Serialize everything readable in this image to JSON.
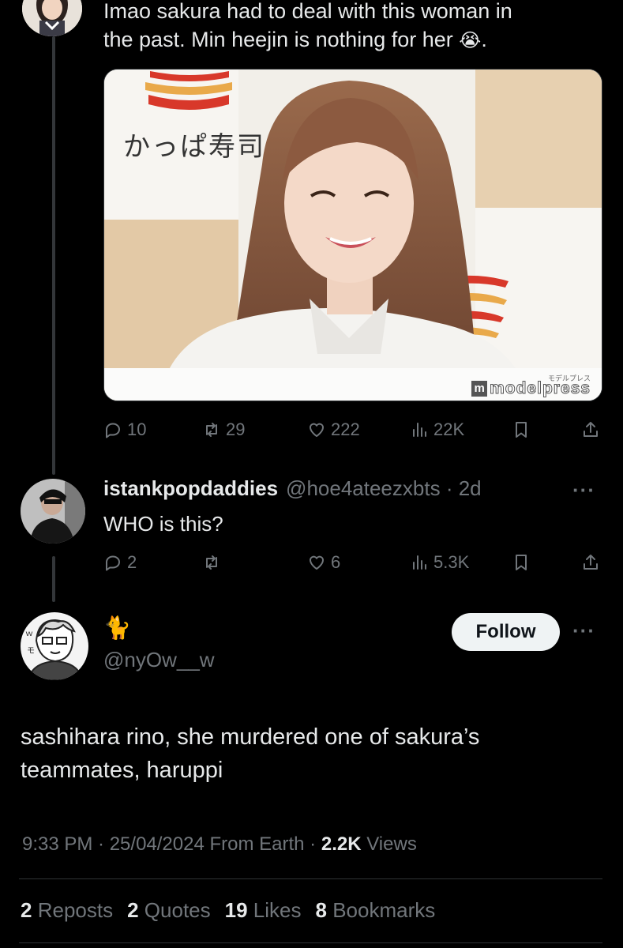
{
  "tweet1": {
    "text_line1": "Imao sakura had to deal with this woman in",
    "text_line2": "the past. Min heejin is nothing for her",
    "emoji": "😭",
    "text_end": ".",
    "media": {
      "sign_text": "かっぱ寿司",
      "watermark_small": "モデルプレス",
      "watermark": "modelpress"
    },
    "actions": {
      "replies": "10",
      "reposts": "29",
      "likes": "222",
      "views": "22K"
    }
  },
  "tweet2": {
    "display_name": "istankpopdaddies",
    "handle": "@hoe4ateezxbts",
    "time": "· 2d",
    "text": "WHO is this?",
    "actions": {
      "replies": "2",
      "reposts": "",
      "likes": "6",
      "views": "5.3K"
    }
  },
  "tweet3": {
    "display_name": "🐈",
    "handle": "@nyOw__w",
    "follow_label": "Follow",
    "text_line1": "sashihara rino, she murdered one of sakura’s",
    "text_line2": "teammates, haruppi",
    "meta": {
      "time": "9:33 PM · 25/04/2024 From Earth ·",
      "views_count": "2.2K",
      "views_label": "Views"
    },
    "stats": {
      "reposts_count": "2",
      "reposts_label": "Reposts",
      "quotes_count": "2",
      "quotes_label": "Quotes",
      "likes_count": "19",
      "likes_label": "Likes",
      "bookmarks_count": "8",
      "bookmarks_label": "Bookmarks"
    }
  },
  "more_icon": "···",
  "colors": {
    "background": "#000000",
    "text": "#e7e9ea",
    "muted": "#71767b",
    "divider": "#2f3336"
  }
}
